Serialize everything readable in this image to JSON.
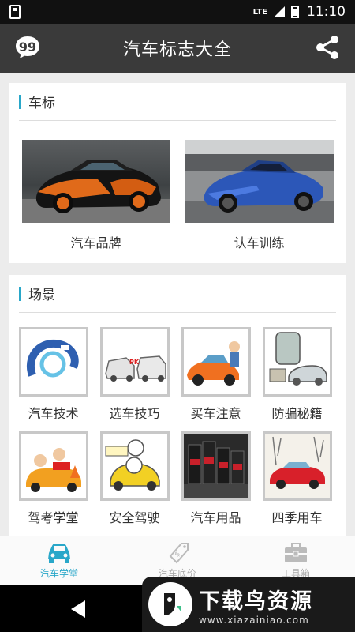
{
  "status_bar": {
    "time": "11:10",
    "network": "LTE"
  },
  "app_bar": {
    "title": "汽车标志大全",
    "left_icon": "chat-quote-icon",
    "right_icon": "share-icon"
  },
  "sections": {
    "brand": {
      "title": "车标",
      "tiles": [
        {
          "label": "汽车品牌",
          "image": "orange-black-supercar"
        },
        {
          "label": "认车训练",
          "image": "blue-supercar"
        }
      ]
    },
    "scene": {
      "title": "场景",
      "items": [
        {
          "label": "汽车技术"
        },
        {
          "label": "选车技巧"
        },
        {
          "label": "买车注意"
        },
        {
          "label": "防骗秘籍"
        },
        {
          "label": "驾考学堂"
        },
        {
          "label": "安全驾驶"
        },
        {
          "label": "汽车用品"
        },
        {
          "label": "四季用车"
        }
      ]
    }
  },
  "tabs": [
    {
      "label": "汽车学堂",
      "icon": "car-icon",
      "active": true
    },
    {
      "label": "汽车底价",
      "icon": "price-tag-icon",
      "active": false
    },
    {
      "label": "工具箱",
      "icon": "toolbox-icon",
      "active": false
    }
  ],
  "watermark": {
    "title": "下载鸟资源",
    "url": "www.xiazainiao.com"
  },
  "colors": {
    "accent": "#29a7c9",
    "appbar": "#3a3a3a",
    "background": "#ececec"
  }
}
